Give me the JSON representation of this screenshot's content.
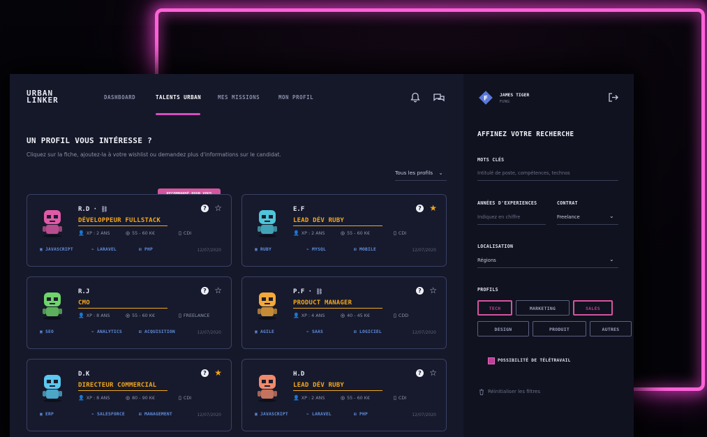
{
  "brand": {
    "logo_line1": "URBAN",
    "logo_line2": "LINKER"
  },
  "nav": [
    {
      "label": "DASHBOARD"
    },
    {
      "label": "TALENTS URBAN"
    },
    {
      "label": "MES MISSIONS"
    },
    {
      "label": "MON PROFIL"
    }
  ],
  "header_icons": [
    "bell-icon",
    "chat-icon"
  ],
  "user": {
    "name": "JAMES TIGER",
    "role": "FUNG",
    "avatar_letter": "F"
  },
  "logout_icon": "logout-icon",
  "page": {
    "title": "UN PROFIL VOUS INTÉRESSE ?",
    "subtitle": "Cliquez sur la fiche, ajoutez-la à votre wishlist ou demandez plus d'informations sur le candidat.",
    "filter_label": "Tous les profils",
    "recommended_badge": "RECOMMANDÉ POUR VOUS"
  },
  "cards": [
    {
      "initials": "R.D",
      "has_link": true,
      "role": "DÉVELOPPEUR FULLSTACK",
      "xp": "XP : 2 ANS",
      "salary": "55 - 60 K€",
      "contract": "CDI",
      "tags": [
        "JAVASCRIPT",
        "LARAVEL",
        "PHP"
      ],
      "date": "12/07/2020",
      "starred": false,
      "avatar_color": "#e05aa8"
    },
    {
      "initials": "E.F",
      "has_link": false,
      "role": "LEAD DÉV RUBY",
      "xp": "XP : 2 ANS",
      "salary": "55 - 60 K€",
      "contract": "CDI",
      "tags": [
        "RUBY",
        "MYSQL",
        "MOBILE"
      ],
      "date": "12/07/2020",
      "starred": true,
      "avatar_color": "#4fc6d9"
    },
    {
      "initials": "R.J",
      "has_link": false,
      "role": "CMO",
      "xp": "XP : 8 ANS",
      "salary": "55 - 60 K€",
      "contract": "FREELANCE",
      "tags": [
        "SEO",
        "ANALYTICS",
        "ACQUISITION"
      ],
      "date": "12/07/2020",
      "starred": false,
      "avatar_color": "#6fd46b"
    },
    {
      "initials": "P.F",
      "has_link": true,
      "role": "PRODUCT MANAGER",
      "xp": "XP : 4 ANS",
      "salary": "40 - 45 K€",
      "contract": "CDD",
      "tags": [
        "AGILE",
        "SAAS",
        "LOGICIEL"
      ],
      "date": "12/07/2020",
      "starred": false,
      "avatar_color": "#f3a83a"
    },
    {
      "initials": "D.K",
      "has_link": false,
      "role": "DIRECTEUR COMMERCIAL",
      "xp": "XP : 8 ANS",
      "salary": "80 - 90 K€",
      "contract": "CDI",
      "tags": [
        "ERP",
        "SALESFORCE",
        "MANAGEMENT"
      ],
      "date": "12/07/2020",
      "starred": true,
      "avatar_color": "#5bc8f0"
    },
    {
      "initials": "H.D",
      "has_link": false,
      "role": "LEAD DÉV RUBY",
      "xp": "XP : 2 ANS",
      "salary": "55 - 60 K€",
      "contract": "CDI",
      "tags": [
        "JAVASCRIPT",
        "LARAVEL",
        "PHP"
      ],
      "date": "12/07/2020",
      "starred": false,
      "avatar_color": "#f08a6c"
    }
  ],
  "sidebar": {
    "title": "AFFINEZ VOTRE RECHERCHE",
    "keywords_label": "MOTS CLÉS",
    "keywords_placeholder": "Intitulé de poste, compétences, technos",
    "experience_label": "ANNÉES D'EXPERIENCES",
    "experience_placeholder": "Indiquez en chiffre",
    "contract_label": "CONTRAT",
    "contract_value": "Freelance",
    "location_label": "LOCALISATION",
    "location_value": "Régions",
    "profiles_label": "PROFILS",
    "profiles": [
      {
        "label": "TECH",
        "selected": true
      },
      {
        "label": "MARKETING",
        "selected": false
      },
      {
        "label": "SALES",
        "selected": true
      },
      {
        "label": "DESIGN",
        "selected": false
      },
      {
        "label": "PRODUIT",
        "selected": false
      },
      {
        "label": "AUTRES",
        "selected": false
      }
    ],
    "remote_label": "POSSIBILITÉ DE TÉLÉTRAVAIL",
    "remote_checked": true,
    "reset_label": "Réinitialiser les filtres"
  },
  "colors": {
    "accent": "#d4559f",
    "highlight": "#f4a81c",
    "neon": "#ff62d8",
    "tag": "#5f8fe0"
  }
}
